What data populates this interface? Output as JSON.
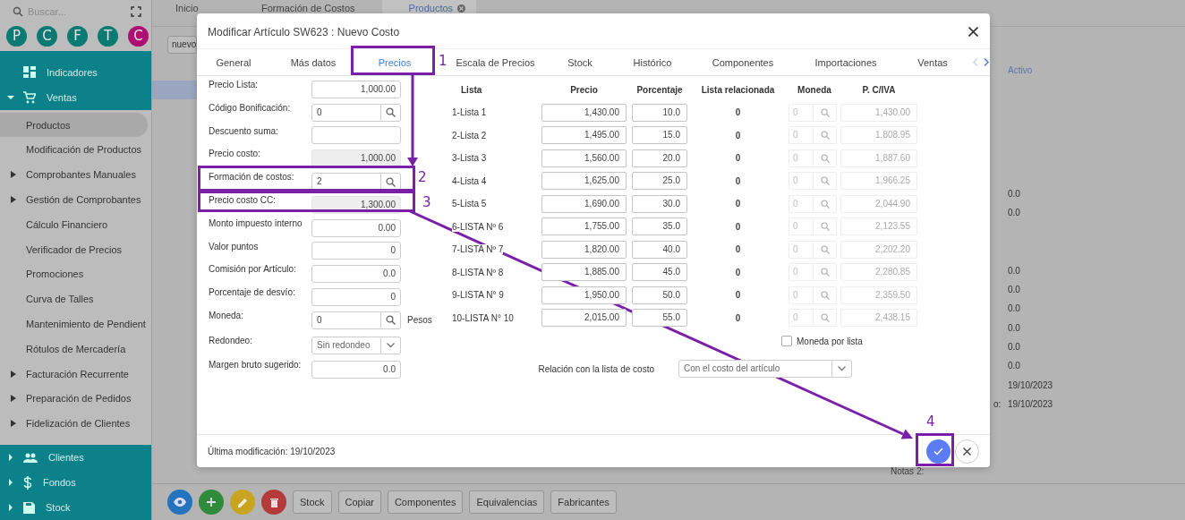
{
  "sidebar": {
    "search_placeholder": "Buscar...",
    "shortcuts": [
      {
        "letter": "P",
        "color": "#0b7a72"
      },
      {
        "letter": "C",
        "color": "#0b7a72"
      },
      {
        "letter": "F",
        "color": "#0b7a72"
      },
      {
        "letter": "T",
        "color": "#0b7a72"
      },
      {
        "letter": "C",
        "color": "#ad1070"
      }
    ],
    "modules": [
      {
        "label": "Indicadores",
        "kind": "link"
      },
      {
        "label": "Ventas",
        "kind": "group",
        "expanded": true,
        "children": [
          {
            "label": "Productos",
            "expandable": false,
            "selected": true
          },
          {
            "label": "Modificación de Productos",
            "expandable": false,
            "selected": false
          },
          {
            "label": "Comprobantes Manuales",
            "expandable": true,
            "selected": false
          },
          {
            "label": "Gestión de Comprobantes",
            "expandable": true,
            "selected": false
          },
          {
            "label": "Cálculo Financiero",
            "expandable": false,
            "selected": false
          },
          {
            "label": "Verificador de Precios",
            "expandable": false,
            "selected": false
          },
          {
            "label": "Promociones",
            "expandable": false,
            "selected": false
          },
          {
            "label": "Curva de Talles",
            "expandable": false,
            "selected": false
          },
          {
            "label": "Mantenimiento de Pendient",
            "expandable": false,
            "selected": false
          },
          {
            "label": "Rótulos de Mercadería",
            "expandable": false,
            "selected": false
          },
          {
            "label": "Facturación Recurrente",
            "expandable": true,
            "selected": false
          },
          {
            "label": "Preparación de Pedidos",
            "expandable": true,
            "selected": false
          },
          {
            "label": "Fidelización de Clientes",
            "expandable": true,
            "selected": false
          }
        ]
      },
      {
        "label": "Clientes",
        "kind": "group",
        "expanded": false
      },
      {
        "label": "Fondos",
        "kind": "group",
        "expanded": false
      },
      {
        "label": "Stock",
        "kind": "group",
        "expanded": false
      }
    ]
  },
  "tabs": [
    {
      "label": "Inicio",
      "selected": false
    },
    {
      "label": "Formación de Costos",
      "selected": false
    },
    {
      "label": "Productos",
      "selected": true
    }
  ],
  "filter": {
    "value": "nuevo"
  },
  "details": {
    "header": "Activo",
    "values": [
      {
        "value": "0.0"
      },
      {
        "value": "0.0"
      },
      {
        "value": "0.0"
      },
      {
        "value": "0.0"
      },
      {
        "value": "0.0"
      },
      {
        "value": "0.0"
      },
      {
        "value": "0.0"
      },
      {
        "value": "0.0"
      },
      {
        "value": "19/10/2023"
      },
      {
        "label": "o:",
        "value": "19/10/2023"
      }
    ],
    "notes_label": "Notas 2:"
  },
  "toolbar": {
    "icon_buttons": [
      {
        "color": "#2373bd"
      },
      {
        "color": "#2f8a3a"
      },
      {
        "color": "#c8a420"
      },
      {
        "color": "#b33b3b"
      }
    ],
    "buttons": [
      "Stock",
      "Copiar",
      "Componentes",
      "Equivalencias",
      "Fabricantes"
    ]
  },
  "modal": {
    "title": "Modificar Artículo SW623 : Nuevo Costo",
    "tabs": [
      {
        "label": "General",
        "selected": false
      },
      {
        "label": "Más datos",
        "selected": false
      },
      {
        "label": "Precios",
        "selected": true
      },
      {
        "label": "Escala de Precios",
        "selected": false
      },
      {
        "label": "Stock",
        "selected": false
      },
      {
        "label": "Histórico",
        "selected": false
      },
      {
        "label": "Componentes",
        "selected": false
      },
      {
        "label": "Importaciones",
        "selected": false
      },
      {
        "label": "Ventas",
        "selected": false
      }
    ],
    "tab_scroll": [
      {
        "disabled": true
      },
      {
        "disabled": false
      }
    ],
    "fields": [
      {
        "label": "Precio Lista:",
        "kind": "input",
        "value": "1,000.00"
      },
      {
        "label": "Código Bonificación:",
        "kind": "search",
        "value": "0"
      },
      {
        "label": "Descuento suma:",
        "kind": "input"
      },
      {
        "label": "Precio costo:",
        "kind": "readonly",
        "value": "1,000.00"
      },
      {
        "label": "Formación de costos:",
        "kind": "search",
        "value": "2"
      },
      {
        "label": "Precio costo CC:",
        "kind": "readonly",
        "value": "1,300.00"
      },
      {
        "label": "Monto impuesto interno",
        "kind": "input",
        "value": "0.00"
      },
      {
        "label": "Valor puntos",
        "kind": "input",
        "value": "0"
      },
      {
        "label": "Comisión por Artículo:",
        "kind": "input",
        "value": "0.0"
      },
      {
        "label": "Porcentaje de desvío:",
        "kind": "input",
        "value": "0"
      },
      {
        "label": "Moneda:",
        "kind": "search",
        "value": "0",
        "suffix": "Pesos"
      },
      {
        "label": "Redondeo:",
        "kind": "select",
        "value": "Sin redondeo"
      },
      {
        "label": "Margen bruto sugerido:",
        "kind": "input",
        "value": "0.0"
      }
    ],
    "columns": [
      "Lista",
      "Precio",
      "Porcentaje",
      "Lista relacionada",
      "Moneda",
      "P. C/IVA"
    ],
    "rows": [
      {
        "name": "1-Lista 1",
        "precio": "1,430.00",
        "porcentaje": "10.0",
        "relacionada": "0",
        "moneda": "0",
        "moneda_disabled": true,
        "iva": "1,430.00"
      },
      {
        "name": "2-Lista 2",
        "precio": "1,495.00",
        "porcentaje": "15.0",
        "relacionada": "0",
        "moneda": "0",
        "moneda_disabled": true,
        "iva": "1,808.95"
      },
      {
        "name": "3-Lista 3",
        "precio": "1,560.00",
        "porcentaje": "20.0",
        "relacionada": "0",
        "moneda": "0",
        "moneda_disabled": true,
        "iva": "1,887.60"
      },
      {
        "name": "4-Lista 4",
        "precio": "1,625.00",
        "porcentaje": "25.0",
        "relacionada": "0",
        "moneda": "0",
        "moneda_disabled": true,
        "iva": "1,966.25"
      },
      {
        "name": "5-Lista 5",
        "precio": "1,690.00",
        "porcentaje": "30.0",
        "relacionada": "0",
        "moneda": "0",
        "moneda_disabled": true,
        "iva": "2,044.90"
      },
      {
        "name": "6-LISTA Nº 6",
        "precio": "1,755.00",
        "porcentaje": "35.0",
        "relacionada": "0",
        "moneda": "0",
        "moneda_disabled": true,
        "iva": "2,123.55"
      },
      {
        "name": "7-LISTA Nº 7",
        "precio": "1,820.00",
        "porcentaje": "40.0",
        "relacionada": "0",
        "moneda": "0",
        "moneda_disabled": true,
        "iva": "2,202.20"
      },
      {
        "name": "8-LISTA Nº 8",
        "precio": "1,885.00",
        "porcentaje": "45.0",
        "relacionada": "0",
        "moneda": "0",
        "moneda_disabled": true,
        "iva": "2,280.85"
      },
      {
        "name": "9-LISTA N° 9",
        "precio": "1,950.00",
        "porcentaje": "50.0",
        "relacionada": "0",
        "moneda": "0",
        "moneda_disabled": true,
        "iva": "2,359.50"
      },
      {
        "name": "10-LISTA N° 10",
        "precio": "2,015.00",
        "porcentaje": "55.0",
        "relacionada": "0",
        "moneda": "0",
        "moneda_disabled": true,
        "iva": "2,438.15"
      }
    ],
    "currency_per_list": {
      "label": "Moneda por lista",
      "checked": false
    },
    "relation": {
      "label": "Relación con la lista de costo",
      "value": "Con el costo del artículo"
    },
    "last_modified": "Última modificación: 19/10/2023"
  },
  "annotations": [
    {
      "label": "1"
    },
    {
      "label": "2"
    },
    {
      "label": "3"
    },
    {
      "label": "4"
    }
  ]
}
